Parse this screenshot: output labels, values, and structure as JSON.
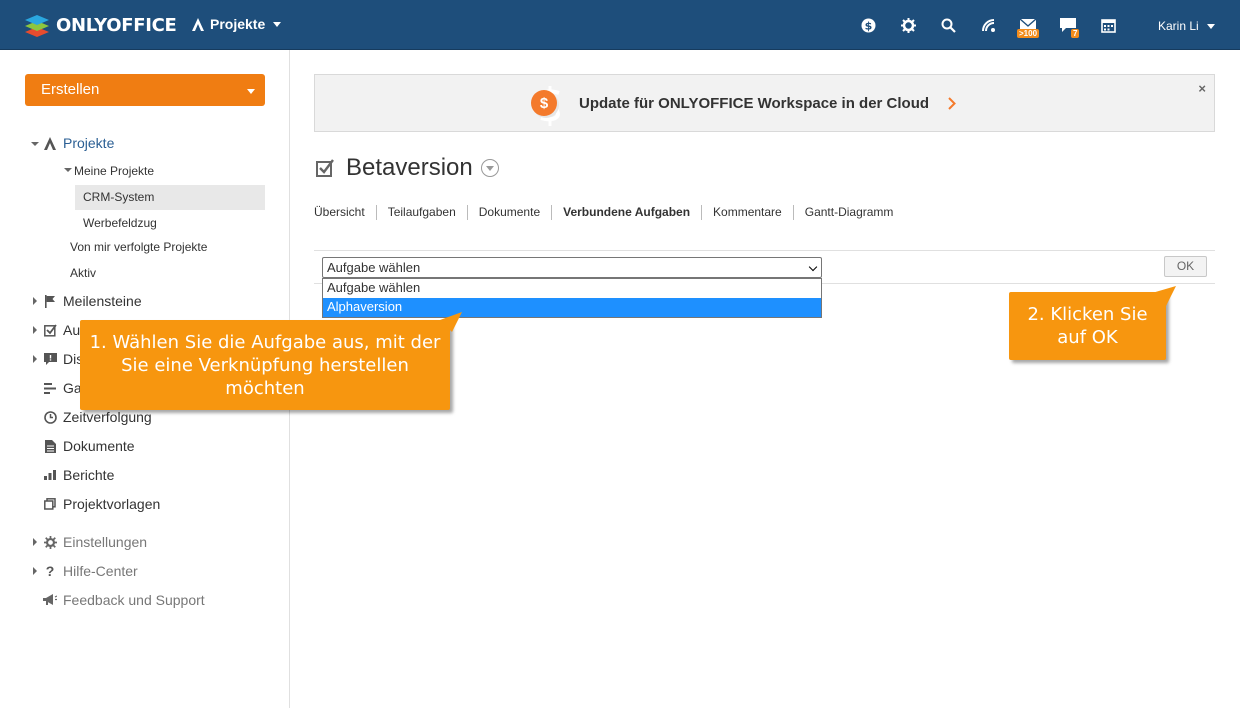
{
  "topbar": {
    "logo_text": "ONLYOFFICE",
    "module_label": "Projekte",
    "mail_badge": ">100",
    "chat_badge": "7",
    "user_name": "Karin Li"
  },
  "sidebar": {
    "create_label": "Erstellen",
    "projects_label": "Projekte",
    "my_projects_label": "Meine Projekte",
    "project_crm": "CRM-System",
    "project_ad": "Werbefeldzug",
    "followed_label": "Von mir verfolgte Projekte",
    "active_label": "Aktiv",
    "milestones_label": "Meilensteine",
    "tasks_label": "Au",
    "discussions_label": "Dis",
    "gantt_label": "Ga",
    "timetracking_label": "Zeitverfolgung",
    "documents_label": "Dokumente",
    "reports_label": "Berichte",
    "templates_label": "Projektvorlagen",
    "settings_label": "Einstellungen",
    "help_label": "Hilfe-Center",
    "feedback_label": "Feedback und Support"
  },
  "banner": {
    "text": "Update für ONLYOFFICE Workspace in der Cloud",
    "close": "×"
  },
  "task": {
    "title": "Betaversion"
  },
  "tabs": [
    {
      "label": "Übersicht"
    },
    {
      "label": "Teilaufgaben"
    },
    {
      "label": "Dokumente"
    },
    {
      "label": "Verbundene Aufgaben"
    },
    {
      "label": "Kommentare"
    },
    {
      "label": "Gantt-Diagramm"
    }
  ],
  "link_row": {
    "select_value": "Aufgabe wählen",
    "options": [
      "Aufgabe wählen",
      "Alphaversion"
    ],
    "ok_label": "OK"
  },
  "callouts": {
    "step1": "1. Wählen Sie die Aufgabe aus, mit der Sie eine Verknüpfung herstellen möchten",
    "step2": "2. Klicken Sie auf OK"
  },
  "colors": {
    "topbar": "#1e4e7b",
    "accent": "#f07d12",
    "callout": "#f7960f",
    "highlight": "#1e90ff"
  }
}
